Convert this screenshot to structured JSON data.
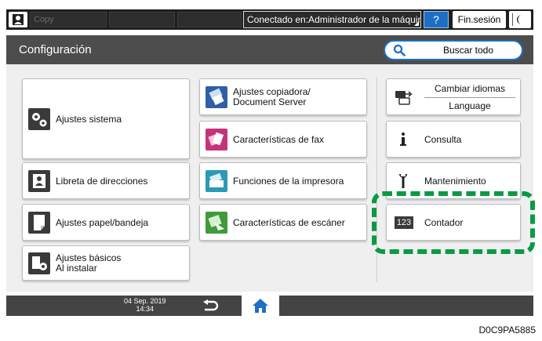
{
  "topbar": {
    "copy_label": "Copy",
    "connected_label": "Conectado en:Administrador de la máquina",
    "help_label": "?",
    "logout_label": "Fin.sesión"
  },
  "header": {
    "title": "Configuración",
    "search_label": "Buscar todo"
  },
  "tiles": {
    "system_settings": "Ajustes sistema",
    "copier_settings_line1": "Ajustes copiadora/",
    "copier_settings_line2": "Document Server",
    "fax_features": "Características de fax",
    "address_book": "Libreta de direcciones",
    "printer_functions": "Funciones de la impresora",
    "paper_tray_settings": "Ajustes papel/bandeja",
    "scanner_features": "Características de escáner",
    "basic_install_line1": "Ajustes básicos",
    "basic_install_line2": "Al instalar",
    "change_language_line1": "Cambiar idiomas",
    "change_language_line2": "Language",
    "inquiry": "Consulta",
    "maintenance": "Mantenimiento",
    "counter_badge": "123",
    "counter": "Contador"
  },
  "bottombar": {
    "date": "04 Sep. 2019",
    "time": "14:34"
  },
  "figure_code": "D0C9PA5885",
  "colors": {
    "accent_blue": "#1e6fc4",
    "highlight_green": "#0a9a44",
    "title_bar": "#4d4d4d",
    "status_bar": "#1f1f1f"
  }
}
